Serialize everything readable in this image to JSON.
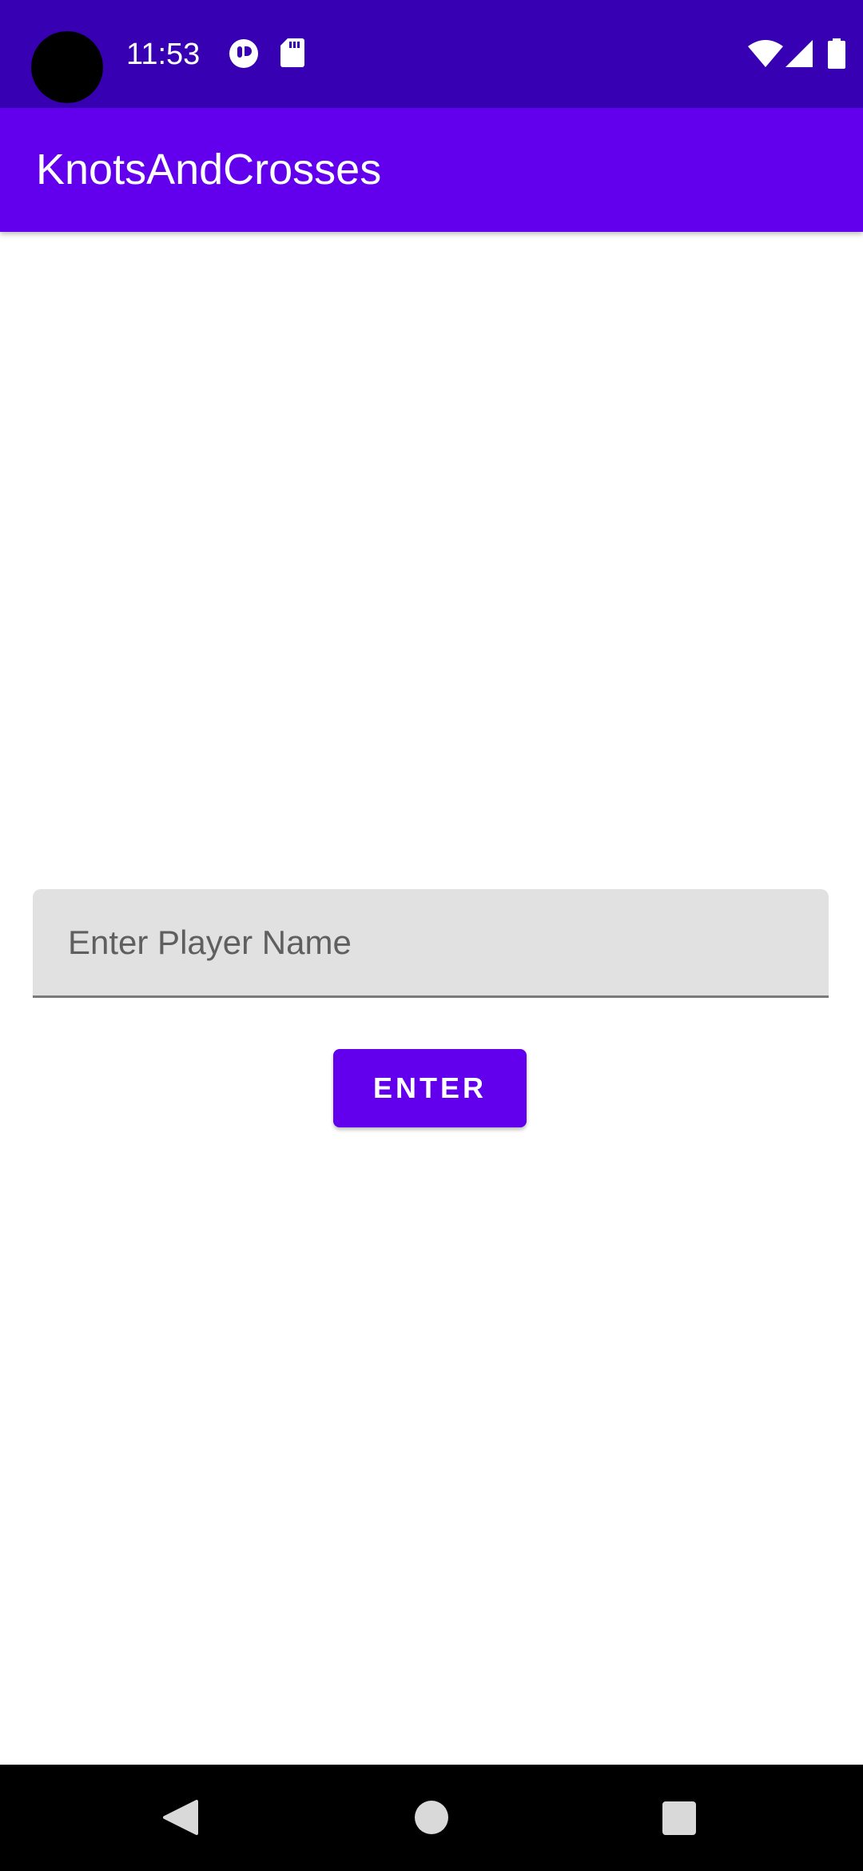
{
  "status_bar": {
    "time": "11:53",
    "icons": [
      "camera-cutout",
      "notification-app-icon",
      "sd-card-icon",
      "wifi-icon",
      "cellular-signal-icon",
      "battery-icon"
    ]
  },
  "app_bar": {
    "title": "KnotsAndCrosses"
  },
  "form": {
    "player_name_value": "",
    "player_name_placeholder": "Enter Player Name",
    "enter_label": "ENTER"
  },
  "nav_bar": {
    "buttons": [
      "back-icon",
      "home-icon",
      "recents-icon"
    ]
  },
  "colors": {
    "status_bar": "#3700b3",
    "primary": "#6200ee",
    "field_background": "#e1e1e1",
    "nav_bar": "#000000"
  }
}
